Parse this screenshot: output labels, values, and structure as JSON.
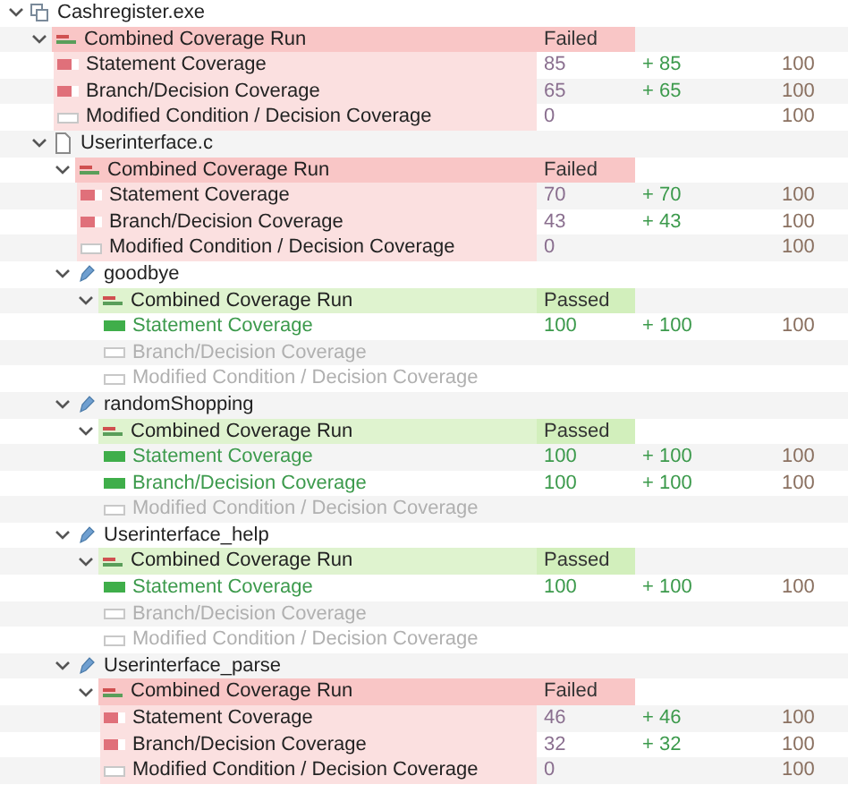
{
  "tree": [
    {
      "name": "Cashregister.exe",
      "kind": "executable",
      "expanded": true,
      "runs": [
        {
          "label": "Combined Coverage Run",
          "status": "Failed",
          "passed": false,
          "expanded": true,
          "metrics": [
            {
              "label": "Statement Coverage",
              "kind": "partial",
              "value": "85",
              "delta": "+ 85",
              "total": "100"
            },
            {
              "label": "Branch/Decision Coverage",
              "kind": "partial",
              "value": "65",
              "delta": "+ 65",
              "total": "100"
            },
            {
              "label": "Modified Condition / Decision Coverage",
              "kind": "empty",
              "value": "0",
              "total": "100"
            }
          ]
        }
      ],
      "children": [
        {
          "name": "Userinterface.c",
          "kind": "file",
          "expanded": true,
          "runs": [
            {
              "label": "Combined Coverage Run",
              "status": "Failed",
              "passed": false,
              "expanded": true,
              "metrics": [
                {
                  "label": "Statement Coverage",
                  "kind": "partial",
                  "value": "70",
                  "delta": "+ 70",
                  "total": "100"
                },
                {
                  "label": "Branch/Decision Coverage",
                  "kind": "partial",
                  "value": "43",
                  "delta": "+ 43",
                  "total": "100"
                },
                {
                  "label": "Modified Condition / Decision Coverage",
                  "kind": "empty",
                  "value": "0",
                  "total": "100"
                }
              ]
            }
          ],
          "children": [
            {
              "name": "goodbye",
              "kind": "function",
              "expanded": true,
              "runs": [
                {
                  "label": "Combined Coverage Run",
                  "status": "Passed",
                  "passed": true,
                  "expanded": true,
                  "metrics": [
                    {
                      "label": "Statement Coverage",
                      "kind": "full",
                      "value": "100",
                      "delta": "+ 100",
                      "total": "100"
                    },
                    {
                      "label": "Branch/Decision Coverage",
                      "kind": "empty"
                    },
                    {
                      "label": "Modified Condition / Decision Coverage",
                      "kind": "empty"
                    }
                  ]
                }
              ]
            },
            {
              "name": "randomShopping",
              "kind": "function",
              "expanded": true,
              "runs": [
                {
                  "label": "Combined Coverage Run",
                  "status": "Passed",
                  "passed": true,
                  "expanded": true,
                  "metrics": [
                    {
                      "label": "Statement Coverage",
                      "kind": "full",
                      "value": "100",
                      "delta": "+ 100",
                      "total": "100"
                    },
                    {
                      "label": "Branch/Decision Coverage",
                      "kind": "full",
                      "value": "100",
                      "delta": "+ 100",
                      "total": "100"
                    },
                    {
                      "label": "Modified Condition / Decision Coverage",
                      "kind": "empty"
                    }
                  ]
                }
              ]
            },
            {
              "name": "Userinterface_help",
              "kind": "function",
              "expanded": true,
              "runs": [
                {
                  "label": "Combined Coverage Run",
                  "status": "Passed",
                  "passed": true,
                  "expanded": true,
                  "metrics": [
                    {
                      "label": "Statement Coverage",
                      "kind": "full",
                      "value": "100",
                      "delta": "+ 100",
                      "total": "100"
                    },
                    {
                      "label": "Branch/Decision Coverage",
                      "kind": "empty"
                    },
                    {
                      "label": "Modified Condition / Decision Coverage",
                      "kind": "empty"
                    }
                  ]
                }
              ]
            },
            {
              "name": "Userinterface_parse",
              "kind": "function",
              "expanded": true,
              "runs": [
                {
                  "label": "Combined Coverage Run",
                  "status": "Failed",
                  "passed": false,
                  "expanded": true,
                  "metrics": [
                    {
                      "label": "Statement Coverage",
                      "kind": "partial",
                      "value": "46",
                      "delta": "+ 46",
                      "total": "100"
                    },
                    {
                      "label": "Branch/Decision Coverage",
                      "kind": "partial",
                      "value": "32",
                      "delta": "+ 32",
                      "total": "100"
                    },
                    {
                      "label": "Modified Condition / Decision Coverage",
                      "kind": "empty",
                      "value": "0",
                      "total": "100"
                    }
                  ]
                }
              ]
            }
          ]
        }
      ]
    }
  ]
}
